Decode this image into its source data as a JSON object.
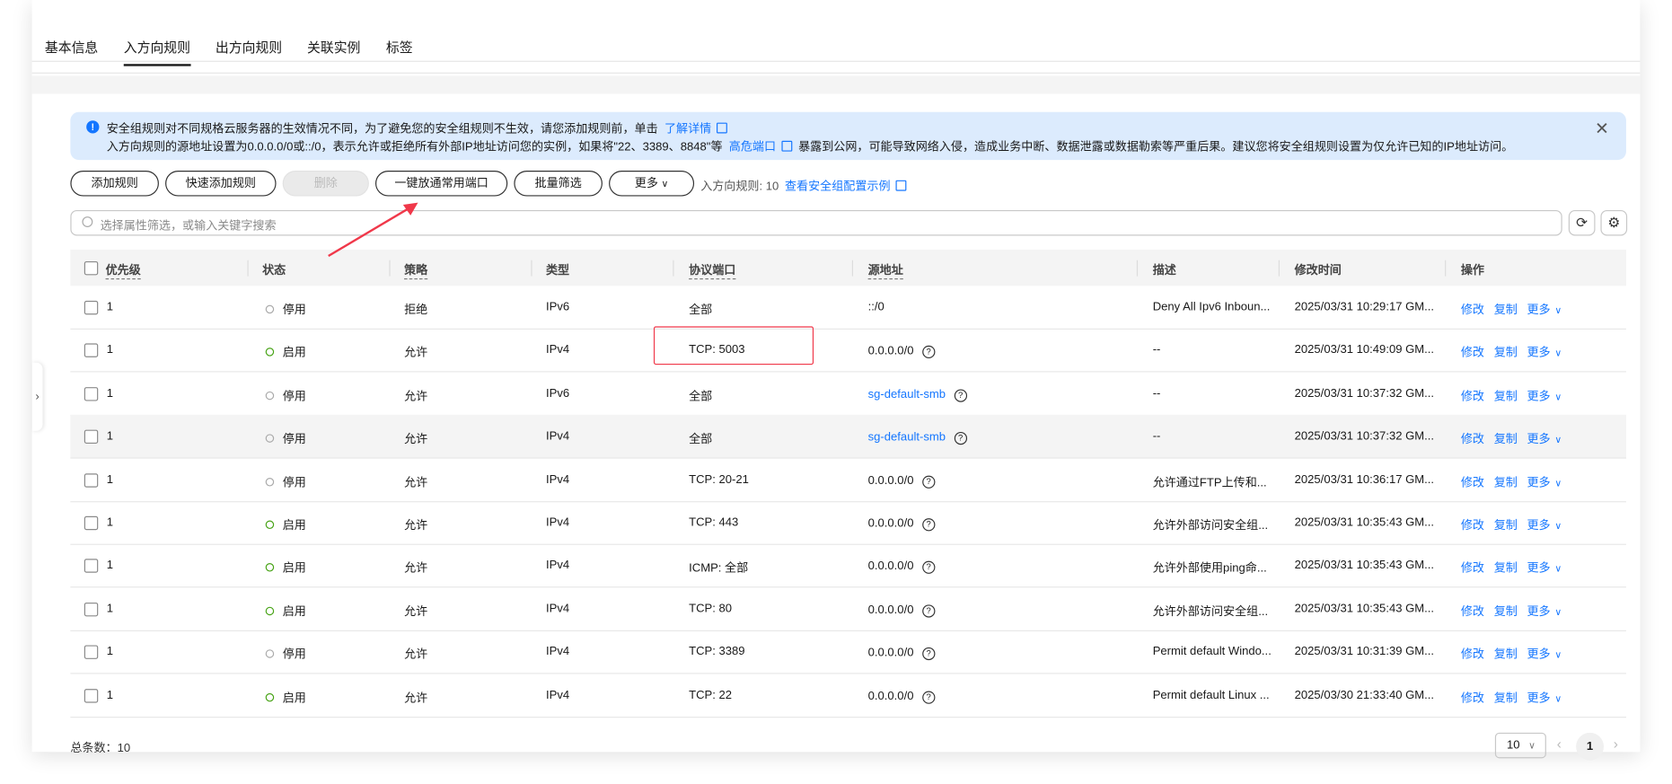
{
  "tabs": [
    "基本信息",
    "入方向规则",
    "出方向规则",
    "关联实例",
    "标签"
  ],
  "active_tab": 1,
  "banner": {
    "line1": "安全组规则对不同规格云服务器的生效情况不同，为了避免您的安全组规则不生效，请您添加规则前，单击",
    "line1_link": "了解详情",
    "line2_a": "入方向规则的源地址设置为0.0.0.0/0或::/0，表示允许或拒绝所有外部IP地址访问您的实例，如果将\"22、3389、8848\"等",
    "line2_link": "高危端口",
    "line2_b": "暴露到公网，可能导致网络入侵，造成业务中断、数据泄露或数据勒索等严重后果。建议您将安全组规则设置为仅允许已知的IP地址访问。",
    "close": "✕"
  },
  "toolbar": {
    "add": "添加规则",
    "quick_add": "快速添加规则",
    "delete": "删除",
    "open_common_ports": "一键放通常用端口",
    "batch_filter": "批量筛选",
    "more": "更多",
    "count": "入方向规则: 10",
    "example_link": "查看安全组配置示例"
  },
  "search": {
    "placeholder": "选择属性筛选，或输入关键字搜索"
  },
  "columns": [
    "优先级",
    "状态",
    "策略",
    "类型",
    "协议端口",
    "源地址",
    "描述",
    "修改时间",
    "操作"
  ],
  "actions": {
    "edit": "修改",
    "copy": "复制",
    "more": "更多"
  },
  "rows": [
    {
      "priority": "1",
      "status": "停用",
      "enabled": false,
      "policy": "拒绝",
      "type": "IPv6",
      "port": "全部",
      "source": "::/0",
      "source_link": false,
      "source_help": false,
      "desc": "Deny All Ipv6 Inboun...",
      "time": "2025/03/31 10:29:17 GM..."
    },
    {
      "priority": "1",
      "status": "启用",
      "enabled": true,
      "policy": "允许",
      "type": "IPv4",
      "port": "TCP: 5003",
      "source": "0.0.0.0/0",
      "source_link": false,
      "source_help": true,
      "desc": "--",
      "time": "2025/03/31 10:49:09 GM..."
    },
    {
      "priority": "1",
      "status": "停用",
      "enabled": false,
      "policy": "允许",
      "type": "IPv6",
      "port": "全部",
      "source": "sg-default-smb",
      "source_link": true,
      "source_help": true,
      "desc": "--",
      "time": "2025/03/31 10:37:32 GM..."
    },
    {
      "priority": "1",
      "status": "停用",
      "enabled": false,
      "policy": "允许",
      "type": "IPv4",
      "port": "全部",
      "source": "sg-default-smb",
      "source_link": true,
      "source_help": true,
      "desc": "--",
      "time": "2025/03/31 10:37:32 GM..."
    },
    {
      "priority": "1",
      "status": "停用",
      "enabled": false,
      "policy": "允许",
      "type": "IPv4",
      "port": "TCP: 20-21",
      "source": "0.0.0.0/0",
      "source_link": false,
      "source_help": true,
      "desc": "允许通过FTP上传和...",
      "time": "2025/03/31 10:36:17 GM..."
    },
    {
      "priority": "1",
      "status": "启用",
      "enabled": true,
      "policy": "允许",
      "type": "IPv4",
      "port": "TCP: 443",
      "source": "0.0.0.0/0",
      "source_link": false,
      "source_help": true,
      "desc": "允许外部访问安全组...",
      "time": "2025/03/31 10:35:43 GM..."
    },
    {
      "priority": "1",
      "status": "启用",
      "enabled": true,
      "policy": "允许",
      "type": "IPv4",
      "port": "ICMP: 全部",
      "source": "0.0.0.0/0",
      "source_link": false,
      "source_help": true,
      "desc": "允许外部使用ping命...",
      "time": "2025/03/31 10:35:43 GM..."
    },
    {
      "priority": "1",
      "status": "启用",
      "enabled": true,
      "policy": "允许",
      "type": "IPv4",
      "port": "TCP: 80",
      "source": "0.0.0.0/0",
      "source_link": false,
      "source_help": true,
      "desc": "允许外部访问安全组...",
      "time": "2025/03/31 10:35:43 GM..."
    },
    {
      "priority": "1",
      "status": "停用",
      "enabled": false,
      "policy": "允许",
      "type": "IPv4",
      "port": "TCP: 3389",
      "source": "0.0.0.0/0",
      "source_link": false,
      "source_help": true,
      "desc": "Permit default Windo...",
      "time": "2025/03/31 10:31:39 GM..."
    },
    {
      "priority": "1",
      "status": "启用",
      "enabled": true,
      "policy": "允许",
      "type": "IPv4",
      "port": "TCP: 22",
      "source": "0.0.0.0/0",
      "source_link": false,
      "source_help": true,
      "desc": "Permit default Linux ...",
      "time": "2025/03/30 21:33:40 GM..."
    }
  ],
  "footer": {
    "total": "总条数：10",
    "page_size": "10",
    "current_page": "1"
  },
  "colors": {
    "link": "#1476ff",
    "enabled": "#47a316",
    "annotation": "#f0384a",
    "banner_bg": "#dcebfd"
  }
}
